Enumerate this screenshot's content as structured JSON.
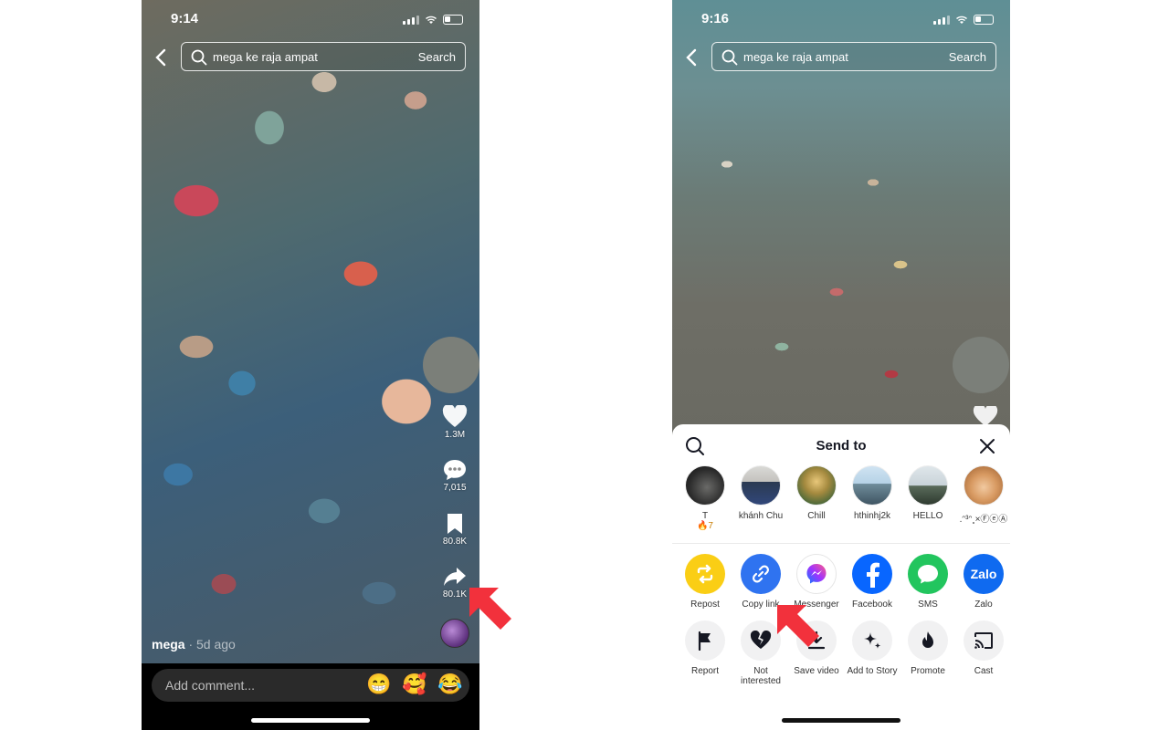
{
  "left_screen": {
    "status_time": "9:14",
    "search": {
      "query": "mega ke raja ampat",
      "button": "Search"
    },
    "actions": [
      {
        "icon": "heart-icon",
        "count": "1.3M"
      },
      {
        "icon": "comment-icon",
        "count": "7,015"
      },
      {
        "icon": "bookmark-icon",
        "count": "80.8K"
      },
      {
        "icon": "share-arrow-icon",
        "count": "80.1K"
      }
    ],
    "author": {
      "name": "mega",
      "time": "· 5d ago"
    },
    "comment": {
      "placeholder": "Add comment...",
      "emojis": [
        "😁",
        "🥰",
        "😂"
      ]
    }
  },
  "right_screen": {
    "status_time": "9:16",
    "search": {
      "query": "mega ke raja ampat",
      "button": "Search"
    },
    "sheet": {
      "title": "Send to",
      "contacts": [
        {
          "name": "T",
          "streak": "🔥7"
        },
        {
          "name": "khánh Chu"
        },
        {
          "name": "Chill"
        },
        {
          "name": "hthinhj2k"
        },
        {
          "name": "HELLO"
        },
        {
          "name": ".ᵔ³ᵔ˳×ⒻⓔⒶ"
        }
      ],
      "share_row_1": [
        {
          "label": "Repost",
          "color": "#FACE15"
        },
        {
          "label": "Copy link",
          "color": "#2F73F0"
        },
        {
          "label": "Messenger",
          "color": "#FFFFFF"
        },
        {
          "label": "Facebook",
          "color": "#0866FF"
        },
        {
          "label": "SMS",
          "color": "#22C55E"
        },
        {
          "label": "Zalo",
          "color": "#0F6AF0"
        }
      ],
      "share_row_2": [
        {
          "label": "Report"
        },
        {
          "label": "Not interested"
        },
        {
          "label": "Save video"
        },
        {
          "label": "Add to Story"
        },
        {
          "label": "Promote"
        },
        {
          "label": "Cast"
        }
      ],
      "zalo_text": "Zalo"
    }
  },
  "colors": {
    "highlight_arrow": "#F2313C"
  }
}
